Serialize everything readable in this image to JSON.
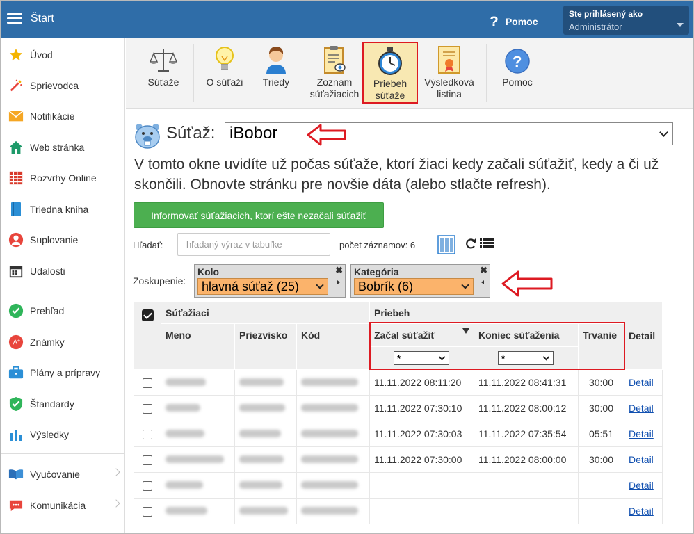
{
  "topbar": {
    "title": "Štart",
    "help": "Pomoc",
    "user_line1": "Ste prihlásený ako",
    "user_line2": "Administrátor"
  },
  "sidebar": {
    "items": [
      {
        "label": "Úvod",
        "icon": "star-icon"
      },
      {
        "label": "Sprievodca",
        "icon": "magic-wand-icon"
      },
      {
        "label": "Notifikácie",
        "icon": "envelope-icon"
      },
      {
        "label": "Web stránka",
        "icon": "house-icon"
      },
      {
        "label": "Rozvrhy Online",
        "icon": "calendar-grid-icon"
      },
      {
        "label": "Triedna kniha",
        "icon": "book-icon"
      },
      {
        "label": "Suplovanie",
        "icon": "person-icon"
      },
      {
        "label": "Udalosti",
        "icon": "calendar-icon"
      },
      {
        "label": "Prehľad",
        "icon": "check-circle-icon"
      },
      {
        "label": "Známky",
        "icon": "grade-icon"
      },
      {
        "label": "Plány a prípravy",
        "icon": "briefcase-icon"
      },
      {
        "label": "Štandardy",
        "icon": "shield-check-icon"
      },
      {
        "label": "Výsledky",
        "icon": "bar-chart-icon"
      },
      {
        "label": "Vyučovanie",
        "icon": "open-book-icon"
      },
      {
        "label": "Komunikácia",
        "icon": "chat-icon"
      }
    ]
  },
  "toolbar": {
    "buttons": [
      {
        "label": "Súťaže"
      },
      {
        "label": "O súťaži"
      },
      {
        "label": "Triedy"
      },
      {
        "label": "Zoznam súťažiacich"
      },
      {
        "label": "Priebeh súťaže"
      },
      {
        "label": "Výsledková listina"
      },
      {
        "label": "Pomoc"
      }
    ]
  },
  "main": {
    "contest_label": "Súťaž:",
    "contest_value": "iBobor",
    "description": "V tomto okne uvidíte už počas súťaže, ktorí žiaci kedy začali súťažiť, kedy a či už skončili. Obnovte stránku pre novšie dáta (alebo stlačte refresh).",
    "notify_button": "Informovať súťažiacich, ktorí ešte nezačali súťažiť",
    "search_label": "Hľadať:",
    "search_placeholder": "hľadaný výraz v tabuľke",
    "record_count": "počet záznamov: 6",
    "grouping_label": "Zoskupenie:",
    "group1": {
      "title": "Kolo",
      "value": "hlavná súťaž (25)"
    },
    "group2": {
      "title": "Kategória",
      "value": "Bobrík (6)"
    }
  },
  "table": {
    "group_contestants": "Súťažiaci",
    "group_progress": "Priebeh",
    "columns": [
      "Meno",
      "Priezvisko",
      "Kód",
      "Začal súťažiť",
      "Koniec súťaženia",
      "Trvanie",
      "Detail"
    ],
    "filter_value": "*",
    "rows": [
      {
        "start": "11.11.2022 08:11:20",
        "end": "11.11.2022 08:41:31",
        "duration": "30:00",
        "detail": "Detail"
      },
      {
        "start": "11.11.2022 07:30:10",
        "end": "11.11.2022 08:00:12",
        "duration": "30:00",
        "detail": "Detail"
      },
      {
        "start": "11.11.2022 07:30:03",
        "end": "11.11.2022 07:35:54",
        "duration": "05:51",
        "detail": "Detail"
      },
      {
        "start": "11.11.2022 07:30:00",
        "end": "11.11.2022 08:00:00",
        "duration": "30:00",
        "detail": "Detail"
      },
      {
        "start": "",
        "end": "",
        "duration": "",
        "detail": "Detail"
      },
      {
        "start": "",
        "end": "",
        "duration": "",
        "detail": "Detail"
      }
    ]
  },
  "colors": {
    "header": "#2f6da8",
    "accent_green": "#4caf50",
    "group_orange": "#fbb36b",
    "highlight_red": "#dd1a22"
  }
}
